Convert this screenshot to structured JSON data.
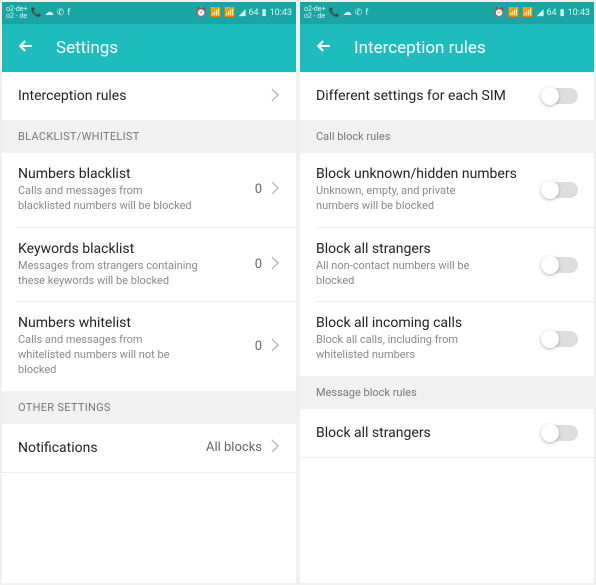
{
  "status": {
    "carrier1": "o2-de+",
    "carrier2": "o2 - de",
    "battery": "64",
    "time": "10:43"
  },
  "left": {
    "title": "Settings",
    "rows": {
      "interception": {
        "label": "Interception rules"
      },
      "section1": "BLACKLIST/WHITELIST",
      "numbersBlacklist": {
        "label": "Numbers blacklist",
        "sub": "Calls and messages from blacklisted numbers will be blocked",
        "value": "0"
      },
      "keywordsBlacklist": {
        "label": "Keywords blacklist",
        "sub": "Messages from strangers containing these keywords will be blocked",
        "value": "0"
      },
      "numbersWhitelist": {
        "label": "Numbers whitelist",
        "sub": "Calls and messages from whitelisted numbers will not be blocked",
        "value": "0"
      },
      "section2": "OTHER SETTINGS",
      "notifications": {
        "label": "Notifications",
        "value": "All blocks"
      }
    }
  },
  "right": {
    "title": "Interception rules",
    "rows": {
      "diffSim": {
        "label": "Different settings for each SIM"
      },
      "section1": "Call block rules",
      "blockUnknown": {
        "label": "Block unknown/hidden numbers",
        "sub": "Unknown, empty, and private numbers will be blocked"
      },
      "blockStrangers": {
        "label": "Block all strangers",
        "sub": "All non-contact numbers will be blocked"
      },
      "blockIncoming": {
        "label": "Block all incoming calls",
        "sub": "Block all calls, including from whitelisted numbers"
      },
      "section2": "Message block rules",
      "blockMsgStrangers": {
        "label": "Block all strangers"
      }
    }
  }
}
